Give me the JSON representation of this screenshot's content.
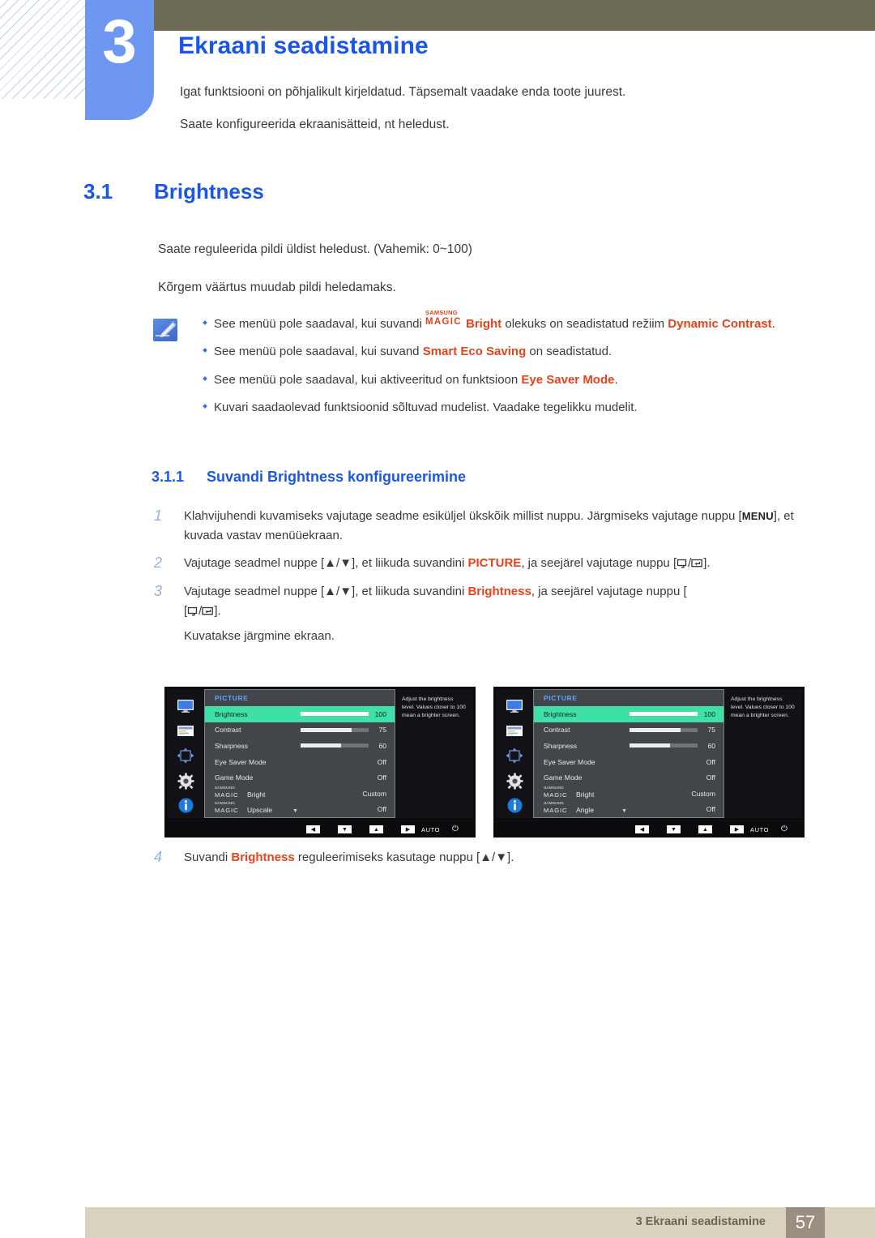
{
  "chapter": {
    "number": "3",
    "title": "Ekraani seadistamine",
    "intro_1": "Igat funktsiooni on põhjalikult kirjeldatud. Täpsemalt vaadake enda toote juurest.",
    "intro_2": "Saate konfigureerida ekraanisätteid, nt heledust."
  },
  "section": {
    "number": "3.1",
    "title": "Brightness",
    "paragraph_1": "Saate reguleerida pildi üldist heledust. (Vahemik: 0~100)",
    "paragraph_2": "Kõrgem väärtus muudab pildi heledamaks."
  },
  "note": {
    "icon": "note-pencil-icon",
    "bullets": [
      {
        "pre": "See menüü pole saadaval, kui suvandi ",
        "magic_small": "SAMSUNG",
        "magic_large": "MAGIC",
        "magic_word": "Bright",
        "mid": " olekuks on seadistatud režiim ",
        "highlight": "Dynamic Contrast",
        "post": "."
      },
      {
        "pre": "See menüü pole saadaval, kui suvand ",
        "highlight": "Smart Eco Saving",
        "post": " on seadistatud."
      },
      {
        "pre": "See menüü pole saadaval, kui aktiveeritud on funktsioon ",
        "highlight": "Eye Saver Mode",
        "post": "."
      },
      {
        "pre": "Kuvari saadaolevad funktsioonid sõltuvad mudelist. Vaadake tegelikku mudelit.",
        "highlight": "",
        "post": ""
      }
    ]
  },
  "subsection": {
    "number": "3.1.1",
    "title": "Suvandi Brightness konfigureerimine",
    "steps": [
      {
        "num": "1",
        "pre": "Klahvijuhendi kuvamiseks vajutage seadme esiküljel ükskõik millist nuppu. Järgmiseks vajutage nuppu [",
        "key": "MENU",
        "post": "], et kuvada vastav menüüekraan."
      },
      {
        "num": "2",
        "pre": "Vajutage seadmel nuppe [▲/▼], et liikuda suvandini ",
        "highlight": "PICTURE",
        "post": ", ja seejärel vajutage nuppu [",
        "tail": "]."
      },
      {
        "num": "3",
        "pre": "Vajutage seadmel nuppe [▲/▼], et liikuda suvandini ",
        "highlight": "Brightness",
        "post": ", ja seejärel vajutage nuppu [",
        "tail": "].",
        "extra": "Kuvatakse järgmine ekraan."
      },
      {
        "num": "4",
        "pre": "Suvandi ",
        "highlight": "Brightness",
        "post": " reguleerimiseks kasutage nuppu [▲/▼]."
      }
    ]
  },
  "osd": {
    "sidebar_icons": [
      "monitor-icon",
      "osd-list-icon",
      "four-way-arrow-icon",
      "gear-icon",
      "info-icon"
    ],
    "title": "PICTURE",
    "description": "Adjust the brightness level. Values closer to 100 mean a brighter screen.",
    "nav": {
      "left_key": "◀",
      "down_key": "▼",
      "up_key": "▲",
      "right_key": "▶",
      "auto_label": "AUTO",
      "power_icon": "power-icon"
    },
    "chevron": "▼",
    "selected_color": "#3fe0a8",
    "screens": [
      {
        "id": "left",
        "rows": [
          {
            "label": "Brightness",
            "value": "100",
            "bar": 100,
            "selected": true
          },
          {
            "label": "Contrast",
            "value": "75",
            "bar": 75,
            "selected": false
          },
          {
            "label": "Sharpness",
            "value": "60",
            "bar": 60,
            "selected": false
          },
          {
            "label": "Eye Saver Mode",
            "value": "Off",
            "bar": null,
            "selected": false
          },
          {
            "label": "Game Mode",
            "value": "Off",
            "bar": null,
            "selected": false
          },
          {
            "label": "Bright",
            "value": "Custom",
            "bar": null,
            "selected": false,
            "magic": true,
            "magic_small": "SAMSUNG",
            "magic_large": "MAGIC"
          },
          {
            "label": "Upscale",
            "value": "Off",
            "bar": null,
            "selected": false,
            "magic": true,
            "magic_small": "SAMSUNG",
            "magic_large": "MAGIC"
          }
        ]
      },
      {
        "id": "right",
        "rows": [
          {
            "label": "Brightness",
            "value": "100",
            "bar": 100,
            "selected": true
          },
          {
            "label": "Contrast",
            "value": "75",
            "bar": 75,
            "selected": false
          },
          {
            "label": "Sharpness",
            "value": "60",
            "bar": 60,
            "selected": false
          },
          {
            "label": "Eye Saver Mode",
            "value": "Off",
            "bar": null,
            "selected": false
          },
          {
            "label": "Game Mode",
            "value": "Off",
            "bar": null,
            "selected": false
          },
          {
            "label": "Bright",
            "value": "Custom",
            "bar": null,
            "selected": false,
            "magic": true,
            "magic_small": "SAMSUNG",
            "magic_large": "MAGIC"
          },
          {
            "label": "Angle",
            "value": "Off",
            "bar": null,
            "selected": false,
            "magic": true,
            "magic_small": "SAMSUNG",
            "magic_large": "MAGIC"
          }
        ]
      }
    ]
  },
  "footer": {
    "text": "3 Ekraani seadistamine",
    "page": "57"
  }
}
